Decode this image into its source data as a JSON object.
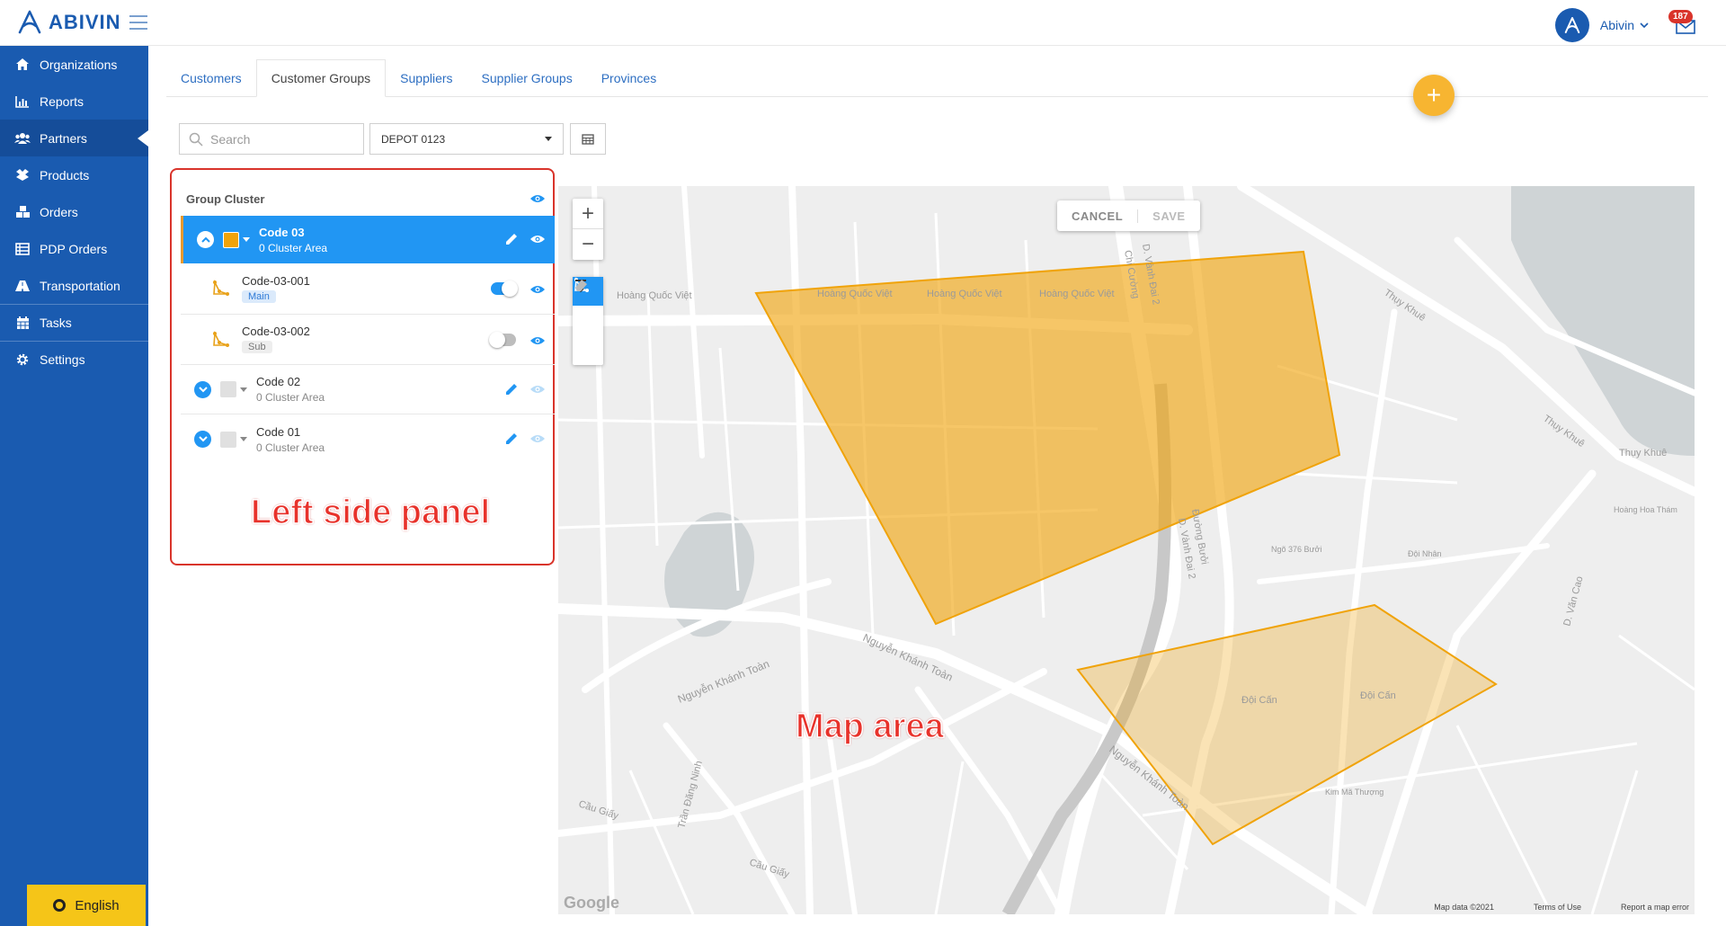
{
  "app": {
    "logo_text": "ABIVIN",
    "user_name": "Abivin",
    "notification_count": "187"
  },
  "sidebar": {
    "items": [
      {
        "label": "Organizations",
        "icon": "home-icon"
      },
      {
        "label": "Reports",
        "icon": "bar-chart-icon"
      },
      {
        "label": "Partners",
        "icon": "users-icon"
      },
      {
        "label": "Products",
        "icon": "boxes-icon"
      },
      {
        "label": "Orders",
        "icon": "cubes-icon"
      },
      {
        "label": "PDP Orders",
        "icon": "list-icon"
      },
      {
        "label": "Transportation",
        "icon": "road-icon"
      },
      {
        "label": "Tasks",
        "icon": "calendar-icon"
      },
      {
        "label": "Settings",
        "icon": "gear-icon"
      }
    ],
    "active_item": "Partners",
    "language": "English"
  },
  "tabs": [
    "Customers",
    "Customer Groups",
    "Suppliers",
    "Supplier Groups",
    "Provinces"
  ],
  "active_tab": "Customer Groups",
  "filters": {
    "search_placeholder": "Search",
    "depot_value": "DEPOT 0123"
  },
  "panel": {
    "header": "Group Cluster",
    "annotation": "Left side panel",
    "groups": [
      {
        "code": "Code 03",
        "subtitle": "0 Cluster Area",
        "selected": true,
        "color": "#f0a30a",
        "children": [
          {
            "code": "Code-03-001",
            "tag": "Main",
            "enabled": true
          },
          {
            "code": "Code-03-002",
            "tag": "Sub",
            "enabled": false
          }
        ]
      },
      {
        "code": "Code 02",
        "subtitle": "0 Cluster Area",
        "selected": false
      },
      {
        "code": "Code 01",
        "subtitle": "0 Cluster Area",
        "selected": false
      }
    ]
  },
  "map": {
    "annotation": "Map area",
    "cancel_label": "CANCEL",
    "save_label": "SAVE",
    "attribution": "Google",
    "map_data": "Map data ©2021",
    "terms": "Terms of Use",
    "report": "Report a map error",
    "polygon_color": "#f0a30a",
    "street_labels": [
      "Hoàng Quốc Việt",
      "Hoàng Quốc Việt",
      "Hoàng Quốc Việt",
      "Hoàng Quốc Việt",
      "Nguyễn Khánh Toàn",
      "Nguyễn Khánh Toàn",
      "Nguyễn Khánh Toàn",
      "Thụy Khuê",
      "Thụy Khuê",
      "Thụy Khuê",
      "Đường Bưởi",
      "D. Vành Đai 2",
      "D. Vành Đai 2",
      "Cầu Giấy",
      "Cầu Giấy",
      "Đội Cấn",
      "Đội Cấn",
      "Trần Đăng Ninh",
      "Kim Mã Thượng",
      "Chi Cường",
      "D. Văn Cao",
      "Đội Nhân",
      "Hoàng Hoa Thám",
      "Ngõ 376 Bưởi"
    ]
  }
}
